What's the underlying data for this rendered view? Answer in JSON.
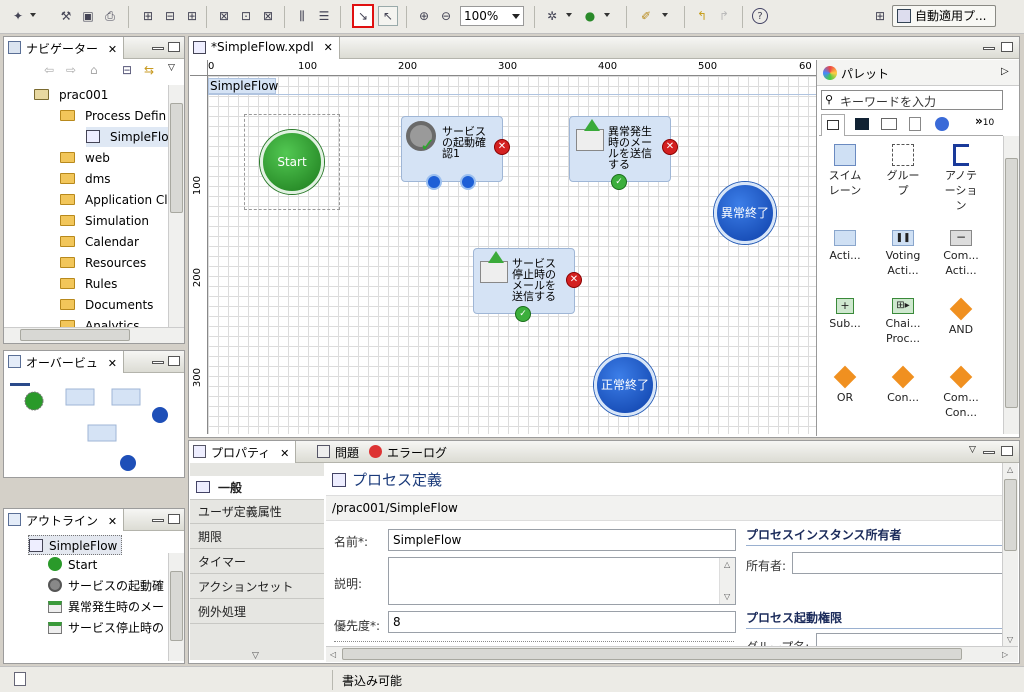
{
  "toolbar": {
    "zoom_value": "100%",
    "perspective_label": "自動適用プ..."
  },
  "navigator": {
    "title": "ナビゲーター",
    "items": [
      {
        "label": "prac001"
      },
      {
        "label": "Process Defin"
      },
      {
        "label": "SimpleFlo"
      },
      {
        "label": "web"
      },
      {
        "label": "dms"
      },
      {
        "label": "Application Cl"
      },
      {
        "label": "Simulation"
      },
      {
        "label": "Calendar"
      },
      {
        "label": "Resources"
      },
      {
        "label": "Rules"
      },
      {
        "label": "Documents"
      },
      {
        "label": "Analytics"
      }
    ]
  },
  "overview": {
    "title": "オーバービュ"
  },
  "outline": {
    "title": "アウトライン",
    "items": [
      {
        "label": "SimpleFlow"
      },
      {
        "label": "Start"
      },
      {
        "label": "サービスの起動確"
      },
      {
        "label": "異常発生時のメー"
      },
      {
        "label": "サービス停止時の"
      }
    ]
  },
  "editor": {
    "tab_label": "*SimpleFlow.xpdl",
    "pool_label": "SimpleFlow",
    "hruler": [
      "0",
      "100",
      "200",
      "300",
      "400",
      "500",
      "60"
    ],
    "vruler": [
      "100",
      "200",
      "300"
    ],
    "nodes": {
      "start": "Start",
      "service_check": [
        "サービス",
        "の起動確",
        "認1"
      ],
      "error_mail": [
        "異常発生",
        "時のメー",
        "ルを送信",
        "する"
      ],
      "stop_mail": [
        "サービス",
        "停止時の",
        "メールを",
        "送信する"
      ],
      "error_end": "異常終了",
      "normal_end": "正常終了"
    }
  },
  "palette": {
    "title": "パレット",
    "search_placeholder": "キーワードを入力",
    "more_tabs": "10",
    "items": [
      [
        "スイム",
        "レーン"
      ],
      [
        "グルー",
        "プ"
      ],
      [
        "アノテ",
        "ーショ",
        "ン"
      ],
      [
        "Acti..."
      ],
      [
        "Voting",
        "Acti..."
      ],
      [
        "Com...",
        "Acti..."
      ],
      [
        "Sub..."
      ],
      [
        "Chai...",
        "Proc..."
      ],
      [
        "AND"
      ],
      [
        "OR"
      ],
      [
        "Con..."
      ],
      [
        "Com...",
        "Con..."
      ]
    ]
  },
  "bottom_tabs": {
    "properties": "プロパティ",
    "problems": "問題",
    "error_log": "エラーログ"
  },
  "properties": {
    "sections": [
      "一般",
      "ユーザ定義属性",
      "期限",
      "タイマー",
      "アクションセット",
      "例外処理"
    ],
    "header_title": "プロセス定義",
    "path": "/prac001/SimpleFlow",
    "name_label": "名前*:",
    "name_value": "SimpleFlow",
    "desc_label": "説明:",
    "priority_label": "優先度*:",
    "priority_value": "8",
    "owner_section": "プロセスインスタンス所有者",
    "owner_label": "所有者:",
    "start_auth_section": "プロセス起動権限",
    "group_label": "グループ名:"
  },
  "status": {
    "writable": "書込み可能"
  }
}
